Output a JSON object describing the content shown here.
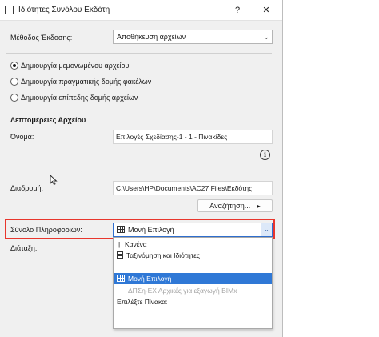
{
  "window": {
    "title": "Ιδιότητες Συνόλου Εκδότη",
    "help_label": "?",
    "close_label": "✕"
  },
  "method": {
    "label": "Μέθοδος Έκδοσης:",
    "value": "Αποθήκευση αρχείων"
  },
  "structure_options": [
    {
      "label": "Δημιουργία μεμονωμένου αρχείου",
      "selected": true
    },
    {
      "label": "Δημιουργία πραγματικής δομής φακέλων",
      "selected": false
    },
    {
      "label": "Δημιουργία επίπεδης δομής αρχείων",
      "selected": false
    }
  ],
  "file_details": {
    "heading": "Λεπτομέρειες Αρχείου",
    "name_label": "Όνομα:",
    "name_value": "Επιλογές Σχεδίασης-1 - 1 - Πινακίδες",
    "info_icon": "i",
    "path_label": "Διαδρομή:",
    "path_value": "C:\\Users\\HP\\Documents\\AC27 Files\\Εκδότης",
    "browse_label": "Αναζήτηση...",
    "browse_arrow": "▸"
  },
  "info_set": {
    "label": "Σύνολο Πληροφοριών:",
    "value": "Μονή Επιλογή",
    "arrow": "⌄"
  },
  "layout_label": "Διάταξη:",
  "dropdown": {
    "items": [
      {
        "label": "Κανένα",
        "prefix": "|",
        "state": "normal"
      },
      {
        "label": "Ταξινόμηση και Ιδιότητες",
        "prefix": "doc",
        "state": "normal"
      },
      {
        "label": "Μονή Επιλογή",
        "prefix": "grid",
        "state": "selected"
      },
      {
        "label": "ΔΠΣη-ΕΧ Αρχικές για εξαγωγή BIMx",
        "prefix": "",
        "state": "disabled"
      },
      {
        "label": "Επιλέξτε Πίνακα:",
        "prefix": "",
        "state": "normal"
      }
    ]
  },
  "colors": {
    "highlight": "#e8362d",
    "selection": "#2f78d6"
  }
}
